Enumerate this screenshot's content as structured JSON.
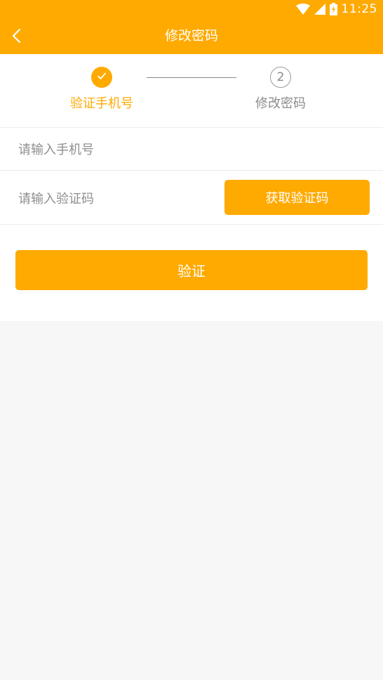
{
  "status_bar": {
    "time": "11:25",
    "icons": [
      "wifi-icon",
      "signal-icon",
      "battery-charging-icon"
    ]
  },
  "app_bar": {
    "title": "修改密码",
    "back_icon": "chevron-left-icon"
  },
  "steps": [
    {
      "label": "验证手机号",
      "state": "done",
      "icon": "check-icon"
    },
    {
      "label": "修改密码",
      "state": "pending",
      "number": "2"
    }
  ],
  "form": {
    "phone": {
      "value": "",
      "placeholder": "请输入手机号"
    },
    "code": {
      "value": "",
      "placeholder": "请输入验证码"
    },
    "get_code_label": "获取验证码",
    "submit_label": "验证"
  },
  "colors": {
    "accent": "#ffaa00",
    "page_background": "#f7f7f7",
    "card_background": "#ffffff",
    "muted_text": "#8c8c8c"
  }
}
